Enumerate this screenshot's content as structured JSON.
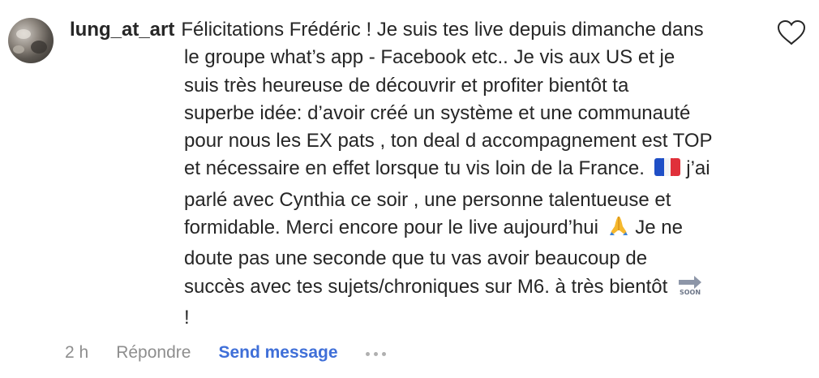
{
  "comment": {
    "username": "lung_at_art",
    "lines": [
      "Félicitations Frédéric ! Je suis tes live depuis dimanche dans",
      "le groupe what’s app - Facebook etc.. Je vis aux US et je",
      "suis très heureuse de découvrir et profiter bientôt ta",
      "superbe idée: d’avoir créé un système et une communauté",
      "pour nous les EX pats , ton deal d accompagnement est TOP",
      "et nécessaire en effet lorsque tu vis loin de la France.",
      "j’ai",
      "parlé avec Cynthia ce soir , une personne talentueuse et",
      "formidable. Merci encore pour le live aujourd’hui",
      "Je ne",
      "doute pas une seconde que tu vas avoir beaucoup de",
      "succès avec tes sujets/chroniques sur M6. à très bientôt",
      "!"
    ],
    "emojis": {
      "flag": "france-flag-emoji",
      "pray": "folded-hands-emoji",
      "soon": "soon-arrow-emoji",
      "soon_text": "SOON"
    }
  },
  "footer": {
    "time": "2 h",
    "reply_label": "Répondre",
    "send_label": "Send message"
  },
  "colors": {
    "text": "#262626",
    "muted": "#8e8e8e",
    "link": "#3f6fd8"
  }
}
